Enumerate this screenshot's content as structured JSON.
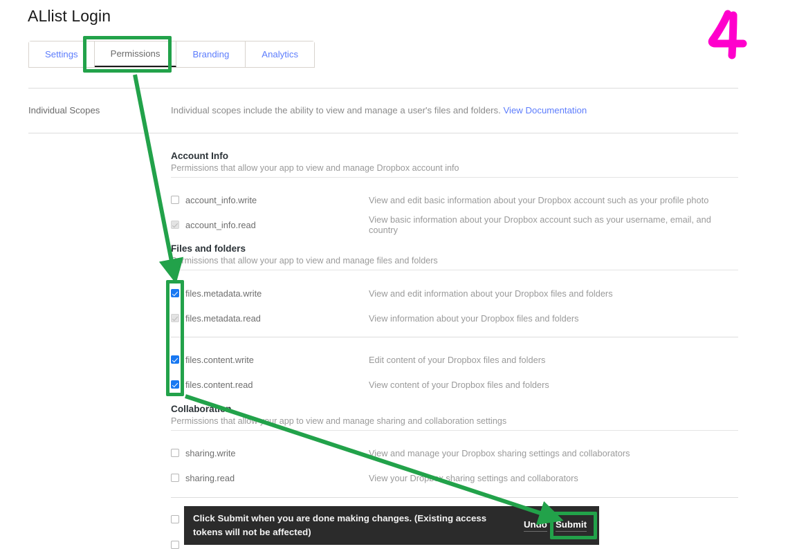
{
  "header": {
    "title": "ALlist Login"
  },
  "tabs": [
    {
      "label": "Settings",
      "active": false
    },
    {
      "label": "Permissions",
      "active": true
    },
    {
      "label": "Branding",
      "active": false
    },
    {
      "label": "Analytics",
      "active": false
    }
  ],
  "individual_scopes": {
    "label": "Individual Scopes",
    "description": "Individual scopes include the ability to view and manage a user's files and folders.",
    "link_label": "View Documentation"
  },
  "groups": [
    {
      "title": "Account Info",
      "subtitle": "Permissions that allow your app to view and manage Dropbox account info"
    },
    {
      "title": "Files and folders",
      "subtitle": "Permissions that allow your app to view and manage files and folders"
    },
    {
      "title": "Collaboration",
      "subtitle": "Permissions that allow your app to view and manage sharing and collaboration settings"
    }
  ],
  "scopes": [
    {
      "name": "account_info.write",
      "description": "View and edit basic information about your Dropbox account such as your profile photo",
      "state": "unchecked"
    },
    {
      "name": "account_info.read",
      "description": "View basic information about your Dropbox account such as your username, email, and country",
      "state": "disabled-checked"
    },
    {
      "name": "files.metadata.write",
      "description": "View and edit information about your Dropbox files and folders",
      "state": "checked"
    },
    {
      "name": "files.metadata.read",
      "description": "View information about your Dropbox files and folders",
      "state": "disabled-checked"
    },
    {
      "name": "files.content.write",
      "description": "Edit content of your Dropbox files and folders",
      "state": "checked"
    },
    {
      "name": "files.content.read",
      "description": "View content of your Dropbox files and folders",
      "state": "checked"
    },
    {
      "name": "sharing.write",
      "description": "View and manage your Dropbox sharing settings and collaborators",
      "state": "unchecked"
    },
    {
      "name": "sharing.read",
      "description": "View your Dropbox sharing settings and collaborators",
      "state": "unchecked"
    },
    {
      "name": "",
      "description": "",
      "state": "unchecked"
    },
    {
      "name": "",
      "description": "",
      "state": "unchecked"
    }
  ],
  "banner": {
    "message": "Click Submit when you are done making changes. (Existing access tokens will not be affected)",
    "undo_label": "Undo",
    "submit_label": "Submit"
  },
  "annotation": {
    "step_number": "4",
    "color": "#22a24a",
    "number_color": "#ff00cc"
  }
}
